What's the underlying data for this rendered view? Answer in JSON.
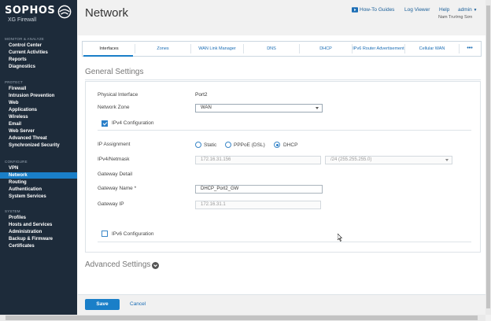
{
  "brand": {
    "name": "SOPHOS",
    "product": "XG Firewall"
  },
  "sidebar": {
    "sections": [
      {
        "title": "MONITOR & ANALYZE",
        "items": [
          "Control Center",
          "Current Activities",
          "Reports",
          "Diagnostics"
        ]
      },
      {
        "title": "PROTECT",
        "items": [
          "Firewall",
          "Intrusion Prevention",
          "Web",
          "Applications",
          "Wireless",
          "Email",
          "Web Server",
          "Advanced Threat",
          "Synchronized Security"
        ]
      },
      {
        "title": "CONFIGURE",
        "items": [
          "VPN",
          "Network",
          "Routing",
          "Authentication",
          "System Services"
        ]
      },
      {
        "title": "SYSTEM",
        "items": [
          "Profiles",
          "Hosts and Services",
          "Administration",
          "Backup & Firmware",
          "Certificates"
        ]
      }
    ],
    "active_item": "Network"
  },
  "header": {
    "title": "Network",
    "links": {
      "guides": "How-To Guides",
      "log_viewer": "Log Viewer",
      "help": "Help",
      "admin": "admin"
    },
    "user": "Nam Trường Sơn"
  },
  "tabs": [
    "Interfaces",
    "Zones",
    "WAN Link Manager",
    "DNS",
    "DHCP",
    "IPv6 Router Advertisement",
    "Cellular WAN",
    "•••"
  ],
  "active_tab": "Interfaces",
  "general": {
    "title": "General Settings",
    "physical_interface_label": "Physical Interface",
    "physical_interface_value": "Port2",
    "network_zone_label": "Network Zone",
    "network_zone_value": "WAN",
    "ipv4_config_label": "IPv4 Configuration",
    "ipv4_checked": true,
    "ip_assignment_label": "IP Assignment",
    "ip_assignment_options": [
      "Static",
      "PPPoE (DSL)",
      "DHCP"
    ],
    "ip_assignment_selected": "DHCP",
    "ipv4_netmask_label": "IPv4/Netmask",
    "ipv4_value": "172.16.31.156",
    "netmask_value": "/24 (255.255.255.0)",
    "gateway_detail_label": "Gateway Detail",
    "gateway_name_label": "Gateway Name *",
    "gateway_name_value": "DHCP_Port2_GW",
    "gateway_ip_label": "Gateway IP",
    "gateway_ip_value": "172.16.31.1",
    "ipv6_config_label": "IPv6 Configuration",
    "ipv6_checked": false
  },
  "advanced": {
    "title": "Advanced Settings"
  },
  "actions": {
    "save": "Save",
    "cancel": "Cancel"
  },
  "colors": {
    "sidebar": "#1d2b3a",
    "accent": "#1a7fc8"
  }
}
